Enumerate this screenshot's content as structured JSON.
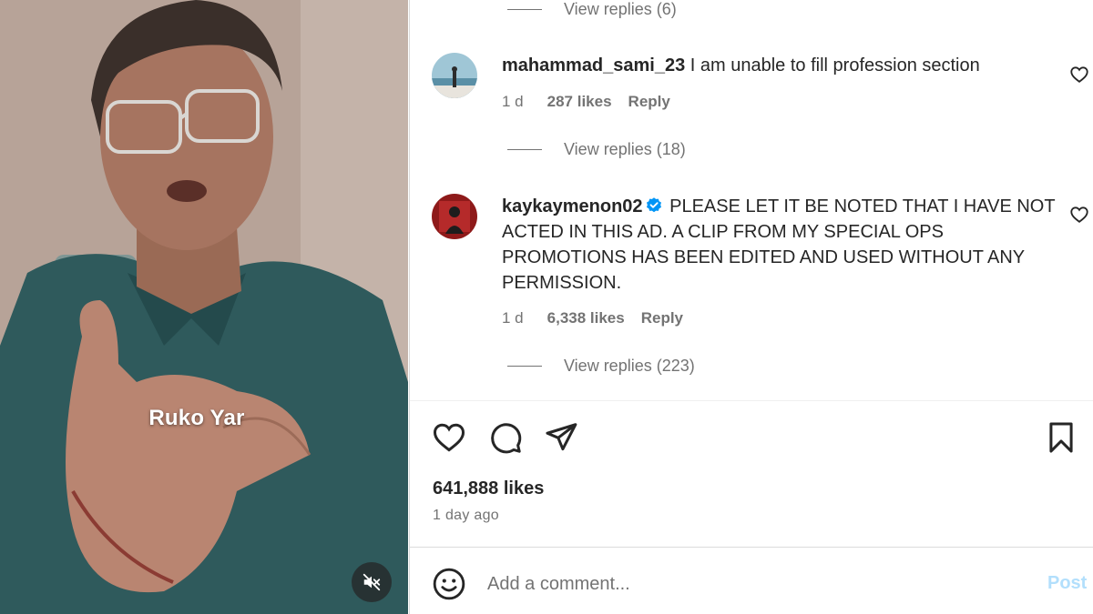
{
  "video": {
    "caption": "Ruko Yar",
    "mute_icon": "speaker-muted-icon"
  },
  "comments": {
    "view_replies_top": "View replies (6)",
    "items": [
      {
        "username": "mahammad_sami_23",
        "text": "I am unable to fill profession section",
        "time": "1 d",
        "likes": "287 likes",
        "reply": "Reply",
        "view_replies": "View replies (18)",
        "verified": false
      },
      {
        "username": "kaykaymenon02",
        "text": "PLEASE LET IT BE NOTED THAT I HAVE NOT ACTED IN THIS AD. A CLIP FROM MY SPECIAL OPS PROMOTIONS HAS BEEN EDITED AND USED WITHOUT ANY PERMISSION.",
        "time": "1 d",
        "likes": "6,338 likes",
        "reply": "Reply",
        "view_replies": "View replies (223)",
        "verified": true
      }
    ]
  },
  "post": {
    "likes": "641,888 likes",
    "posted": "1 day ago"
  },
  "add_comment": {
    "placeholder": "Add a comment...",
    "post_label": "Post"
  },
  "colors": {
    "text": "#262626",
    "muted": "#737373",
    "verified": "#0095f6",
    "post_disabled": "#b2dffc",
    "divider": "#dbdbdb"
  },
  "icons": [
    "heart-icon",
    "comment-icon",
    "share-icon",
    "bookmark-icon",
    "emoji-icon",
    "verified-badge-icon",
    "speaker-muted-icon"
  ]
}
